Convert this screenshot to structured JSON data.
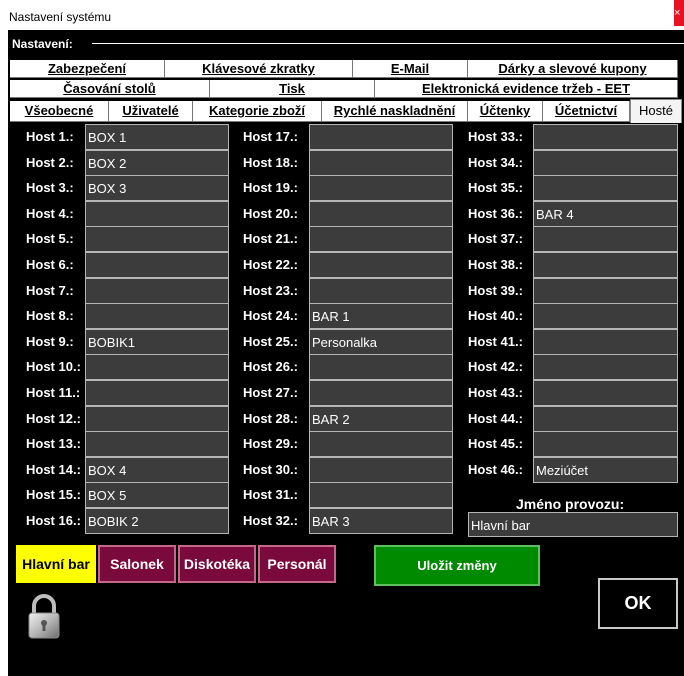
{
  "window": {
    "title": "Nastavení systému",
    "close_glyph": "×"
  },
  "group": {
    "label": "Nastavení:"
  },
  "tabs": {
    "row1": [
      "Zabezpečení",
      "Klávesové zkratky",
      "E-Mail",
      "Dárky a slevové kupony"
    ],
    "row2": [
      "Časování stolů",
      "Tisk",
      "Elektronická evidence tržeb - EET"
    ],
    "row3": [
      "Všeobecné",
      "Uživatelé",
      "Kategorie zboží",
      "Rychlé naskladnění",
      "Účtenky",
      "Účetnictví",
      "Hosté"
    ],
    "active": "Hosté"
  },
  "hosts": [
    {
      "label": "Host 1.:",
      "value": "BOX 1"
    },
    {
      "label": "Host 2.:",
      "value": "BOX 2"
    },
    {
      "label": "Host 3.:",
      "value": "BOX 3"
    },
    {
      "label": "Host 4.:",
      "value": ""
    },
    {
      "label": "Host 5.:",
      "value": ""
    },
    {
      "label": "Host 6.:",
      "value": ""
    },
    {
      "label": "Host 7.:",
      "value": ""
    },
    {
      "label": "Host 8.:",
      "value": ""
    },
    {
      "label": "Host 9.:",
      "value": "BOBIK1"
    },
    {
      "label": "Host 10.:",
      "value": ""
    },
    {
      "label": "Host 11.:",
      "value": ""
    },
    {
      "label": "Host 12.:",
      "value": ""
    },
    {
      "label": "Host 13.:",
      "value": ""
    },
    {
      "label": "Host 14.:",
      "value": "BOX 4"
    },
    {
      "label": "Host 15.:",
      "value": "BOX 5"
    },
    {
      "label": "Host 16.:",
      "value": "BOBIK 2"
    },
    {
      "label": "Host 17.:",
      "value": ""
    },
    {
      "label": "Host 18.:",
      "value": ""
    },
    {
      "label": "Host 19.:",
      "value": ""
    },
    {
      "label": "Host 20.:",
      "value": ""
    },
    {
      "label": "Host 21.:",
      "value": ""
    },
    {
      "label": "Host 22.:",
      "value": ""
    },
    {
      "label": "Host 23.:",
      "value": ""
    },
    {
      "label": "Host 24.:",
      "value": "BAR 1"
    },
    {
      "label": "Host 25.:",
      "value": "Personalka"
    },
    {
      "label": "Host 26.:",
      "value": ""
    },
    {
      "label": "Host 27.:",
      "value": ""
    },
    {
      "label": "Host 28.:",
      "value": "BAR 2"
    },
    {
      "label": "Host 29.:",
      "value": ""
    },
    {
      "label": "Host 30.:",
      "value": ""
    },
    {
      "label": "Host 31.:",
      "value": ""
    },
    {
      "label": "Host 32.:",
      "value": "BAR 3"
    },
    {
      "label": "Host 33.:",
      "value": ""
    },
    {
      "label": "Host 34.:",
      "value": ""
    },
    {
      "label": "Host 35.:",
      "value": ""
    },
    {
      "label": "Host 36.:",
      "value": "BAR 4"
    },
    {
      "label": "Host 37.:",
      "value": ""
    },
    {
      "label": "Host 38.:",
      "value": ""
    },
    {
      "label": "Host 39.:",
      "value": ""
    },
    {
      "label": "Host 40.:",
      "value": ""
    },
    {
      "label": "Host 41.:",
      "value": ""
    },
    {
      "label": "Host 42.:",
      "value": ""
    },
    {
      "label": "Host 43.:",
      "value": ""
    },
    {
      "label": "Host 44.:",
      "value": ""
    },
    {
      "label": "Host 45.:",
      "value": ""
    },
    {
      "label": "Host 46.:",
      "value": "Meziúčet"
    }
  ],
  "venue": {
    "label": "Jméno provozu:",
    "value": "Hlavní bar"
  },
  "zones": [
    {
      "label": "Hlavní bar",
      "active": true
    },
    {
      "label": "Salonek",
      "active": false
    },
    {
      "label": "Diskotéka",
      "active": false
    },
    {
      "label": "Personál",
      "active": false
    }
  ],
  "buttons": {
    "save": "Uložit změny",
    "ok": "OK"
  },
  "icons": {
    "lock": "padlock-icon"
  },
  "colors": {
    "background": "#000000",
    "field": "#3c3c3c",
    "zone_active": "#ffff00",
    "zone": "#7a0a3c",
    "save": "#008a00",
    "close": "#e81123"
  }
}
